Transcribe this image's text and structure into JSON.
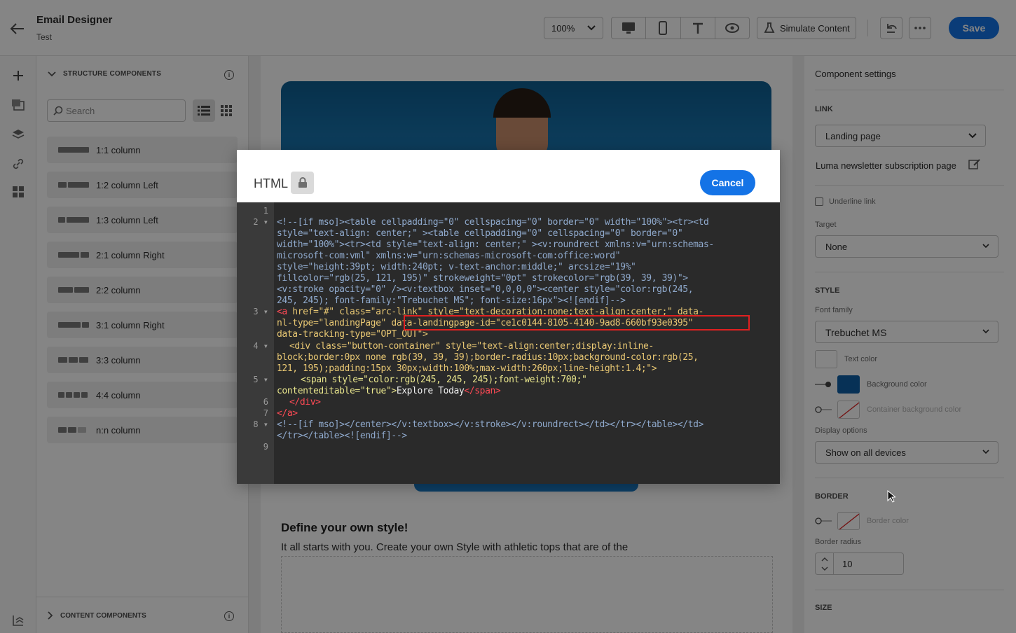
{
  "header": {
    "title": "Email Designer",
    "subtitle": "Test",
    "zoom": "100%",
    "simulate_label": "Simulate Content",
    "save_label": "Save"
  },
  "left_panel": {
    "structure_heading": "STRUCTURE COMPONENTS",
    "search_placeholder": "Search",
    "components": [
      "1:1 column",
      "1:2 column Left",
      "1:3 column Left",
      "2:1 column Right",
      "2:2 column",
      "3:1 column Right",
      "3:3 column",
      "4:4 column",
      "n:n column"
    ],
    "content_heading": "CONTENT COMPONENTS"
  },
  "email": {
    "section_title": "Define your own style!",
    "section_text": "It all starts with you. Create your own Style with athletic tops that are of the"
  },
  "settings": {
    "title": "Component settings",
    "link_heading": "LINK",
    "link_type": "Landing page",
    "landing_page_name": "Luma newsletter subscription page",
    "underline_label": "Underline link",
    "target_label": "Target",
    "target_value": "None",
    "style_heading": "STYLE",
    "font_family_label": "Font family",
    "font_family_value": "Trebuchet MS",
    "text_color_label": "Text color",
    "background_color_label": "Background color",
    "container_bg_label": "Container background color",
    "display_options_label": "Display options",
    "display_options_value": "Show on all devices",
    "border_heading": "BORDER",
    "border_color_label": "Border color",
    "border_radius_label": "Border radius",
    "border_radius_value": "10",
    "size_heading": "SIZE",
    "background_color": "#0e5fa6"
  },
  "modal": {
    "title": "HTML",
    "cancel_label": "Cancel",
    "line_numbers": [
      "1",
      "2",
      "3",
      "4",
      "5",
      "6",
      "7",
      "8",
      "9"
    ],
    "code": {
      "l2a": "<!--[if mso]><table cellpadding=\"0\" cellspacing=\"0\" border=\"0\" width=\"100%\"><tr><td",
      "l2b": "style=\"text-align: center;\" ><table cellpadding=\"0\" cellspacing=\"0\" border=\"0\"",
      "l2c": "width=\"100%\"><tr><td style=\"text-align: center;\" ><v:roundrect xmlns:v=\"urn:schemas-",
      "l2d": "microsoft-com:vml\" xmlns:w=\"urn:schemas-microsoft-com:office:word\"",
      "l2e": "style=\"height:39pt; width:240pt; v-text-anchor:middle;\" arcsize=\"19%\"",
      "l2f": "fillcolor=\"rgb(25, 121, 195)\" strokeweight=\"0pt\" strokecolor=\"rgb(39, 39, 39)\">",
      "l2g": "<v:stroke opacity=\"0\" /><v:textbox inset=\"0,0,0,0\"><center style=\"color:rgb(245,",
      "l2h": "245, 245); font-family:\"Trebuchet MS\"; font-size:16px\"><![endif]-->",
      "l3a_tag": "<a",
      "l3a_rest": " href=\"#\" class=\"arc-link\" style=\"text-decoration:none;text-align:center;\" data-",
      "l3b_a": "nl-type=\"landingPage\"",
      "l3b_hl": "data-landingpage-id=\"ce1c0144-8105-4140-9ad8-660bf93e0395\"",
      "l3c": "data-tracking-type=\"OPT_OUT\">",
      "l4a": "<div class=\"button-container\" style=\"text-align:center;display:inline-",
      "l4b": "block;border:0px none rgb(39, 39, 39);border-radius:10px;background-color:rgb(25,",
      "l4c": "121, 195);padding:15px 30px;width:100%;max-width:260px;line-height:1.4;\">",
      "l5a": "<span style=\"color:rgb(245, 245, 245);font-weight:700;\"",
      "l5b_attr": "contenteditable=\"true\">",
      "l5b_text": "Explore Today",
      "l5b_close": "</span>",
      "l6": "</div>",
      "l7": "</a>",
      "l8a": "<!--[if mso]></center></v:textbox></v:stroke></v:roundrect></td></tr></table></td>",
      "l8b": "</tr></table><![endif]-->"
    }
  }
}
